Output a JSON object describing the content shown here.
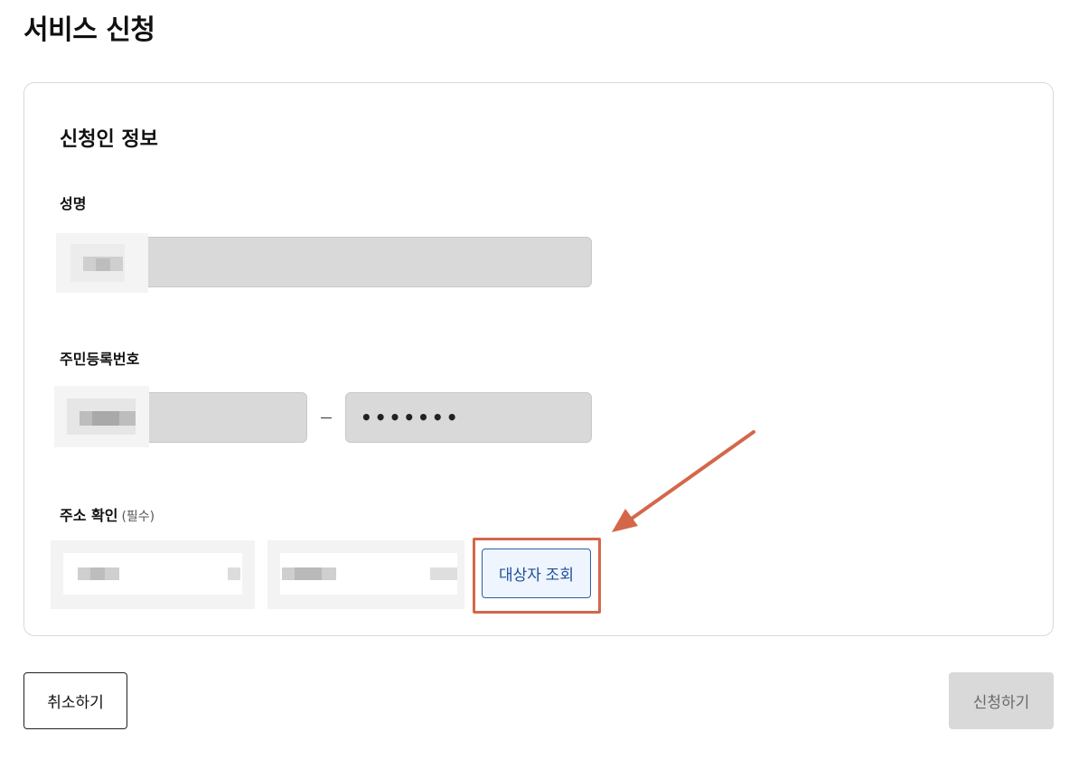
{
  "page": {
    "title": "서비스 신청"
  },
  "applicant": {
    "section_title": "신청인 정보",
    "name": {
      "label": "성명",
      "value": ""
    },
    "resident_number": {
      "label": "주민등록번호",
      "front_value": "",
      "separator": "–",
      "back_value": "•••••••"
    },
    "address": {
      "label": "주소 확인",
      "hint": "(필수)",
      "field1_value": "",
      "field2_value": "",
      "lookup_button_label": "대상자 조회"
    }
  },
  "actions": {
    "cancel_label": "취소하기",
    "submit_label": "신청하기"
  },
  "colors": {
    "highlight": "#d4674a",
    "button_accent": "#2f5c9e",
    "input_disabled_bg": "#d9d9d9"
  },
  "annotations": {
    "arrow_icon": "arrow-pointing-to-lookup-button"
  }
}
